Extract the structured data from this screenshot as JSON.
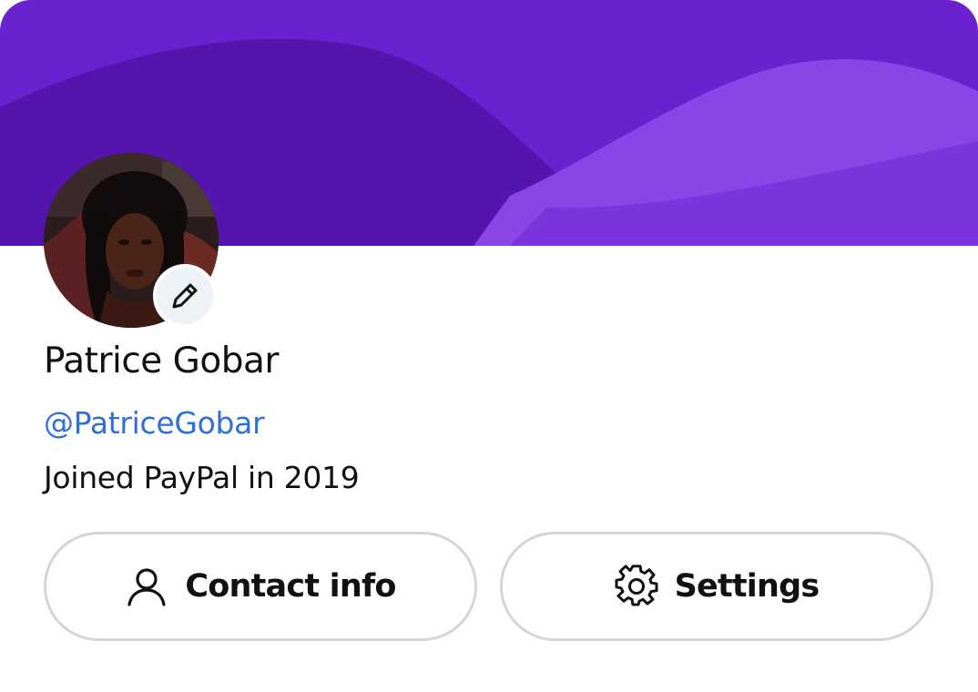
{
  "profile": {
    "name": "Patrice Gobar",
    "handle": "@PatriceGobar",
    "joined": "Joined PayPal in 2019"
  },
  "actions": {
    "contact_label": "Contact info",
    "settings_label": "Settings"
  },
  "icons": {
    "avatar_edit": "pencil-icon",
    "contact": "person-icon",
    "settings": "gear-icon"
  },
  "colors": {
    "banner_primary": "#6a22d0",
    "banner_dark": "#5515ad",
    "banner_light": "#8a45e6",
    "link": "#2f6fd8",
    "button_border": "#d5d5d5"
  }
}
